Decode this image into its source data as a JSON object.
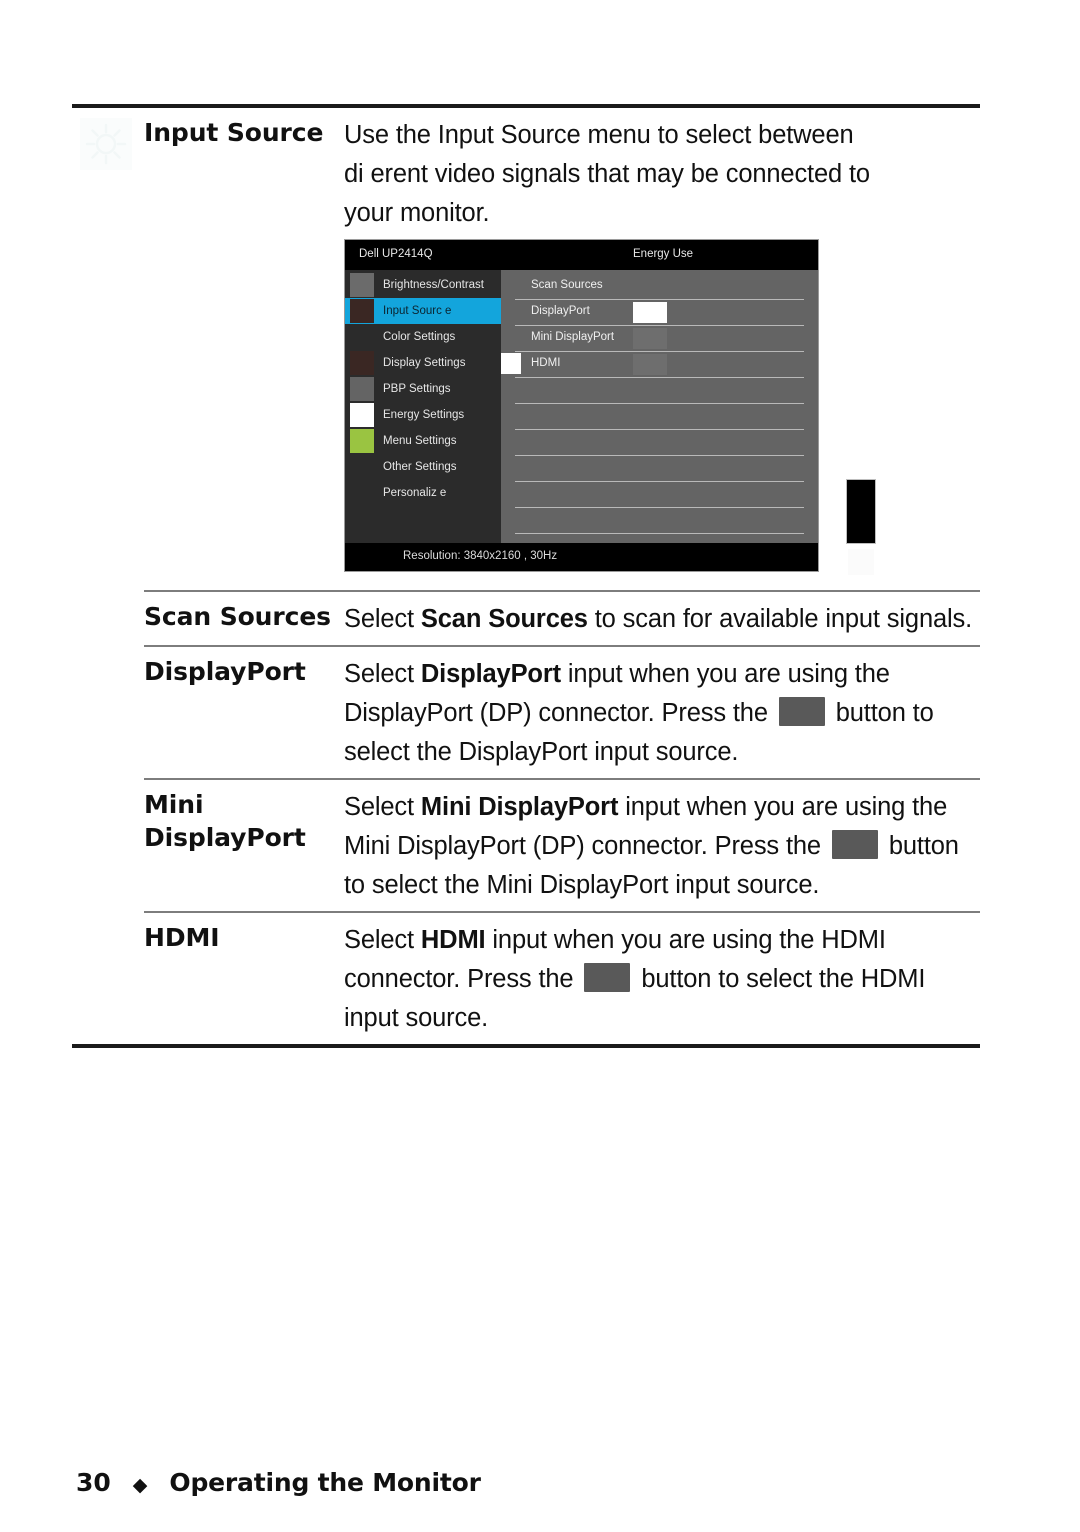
{
  "document": {
    "footer": {
      "page_number": "30",
      "separator": "◆",
      "section_title": "Operating the Monitor"
    }
  },
  "table": {
    "rows": [
      {
        "id": "input-source",
        "icon": "brightness-sun-icon",
        "label": "Input Source",
        "paragraphs": [
          "Use the Input Source menu to select between different video signals that may be connected to your monitor."
        ],
        "text_line1": "Use the Input Source menu to select between",
        "text_line2": "di erent video signals that may be connected to",
        "text_line3": "your monitor."
      },
      {
        "id": "scan-sources",
        "label": "Scan Sources",
        "before": "Select ",
        "bold": "Scan Sources",
        "after": " to scan for available input signals."
      },
      {
        "id": "displayport",
        "label": "DisplayPort",
        "before": "Select ",
        "bold": "DisplayPort",
        "mid": " input when you are using the DisplayPort (DP) connector. Press the ",
        "after": " button to select the DisplayPort input source."
      },
      {
        "id": "mini-displayport",
        "label_line1": "Mini",
        "label_line2": "DisplayPort",
        "label": "Mini DisplayPort",
        "before": "Select ",
        "bold": "Mini DisplayPort",
        "mid": " input when you are using the Mini DisplayPort (DP) connector. Press the ",
        "after": " button to select the Mini DisplayPort input source."
      },
      {
        "id": "hdmi",
        "label": "HDMI",
        "before": "Select ",
        "bold": "HDMI",
        "mid": " input when you are using the HDMI connector. Press the ",
        "after": " button to select the HDMI input source."
      }
    ]
  },
  "osd": {
    "model": "Dell UP2414Q",
    "energy_label": "Energy Use",
    "status": "Resolution: 3840x2160 , 30Hz",
    "colors": {
      "selected_highlight": "#13a5dc",
      "sidebar_bg": "#2b2b2b",
      "panel_bg": "#646464",
      "titlebar_bg": "#000000"
    },
    "menu_items": [
      {
        "label": "Brightness/Contrast",
        "swatch": "#6b6b6b",
        "selected": false
      },
      {
        "label": "Input Sourc e",
        "swatch": "#3a2723",
        "selected": true
      },
      {
        "label": "Color Settings",
        "swatch": "",
        "selected": false
      },
      {
        "label": "Display Settings",
        "swatch": "#3a2723",
        "selected": false
      },
      {
        "label": "PBP Settings",
        "swatch": "#646464",
        "selected": false
      },
      {
        "label": "Energy Settings",
        "swatch": "#ffffff",
        "selected": false
      },
      {
        "label": "Menu Settings",
        "swatch": "#9ac441",
        "selected": false
      },
      {
        "label": "Other Settings",
        "swatch": "",
        "selected": false
      },
      {
        "label": "Personaliz e",
        "swatch": "",
        "selected": false
      }
    ],
    "options": [
      {
        "label": "Scan Sources",
        "chip": false,
        "chip_active": false,
        "marker": false
      },
      {
        "label": "DisplayPort",
        "chip": true,
        "chip_active": true,
        "marker": false
      },
      {
        "label": "Mini DisplayPort",
        "chip": true,
        "chip_active": false,
        "marker": false
      },
      {
        "label": "HDMI",
        "chip": true,
        "chip_active": false,
        "marker": true
      },
      {
        "label": "",
        "chip": false,
        "chip_active": false,
        "marker": false
      },
      {
        "label": "",
        "chip": false,
        "chip_active": false,
        "marker": false
      },
      {
        "label": "",
        "chip": false,
        "chip_active": false,
        "marker": false
      },
      {
        "label": "",
        "chip": false,
        "chip_active": false,
        "marker": false
      },
      {
        "label": "",
        "chip": false,
        "chip_active": false,
        "marker": false
      },
      {
        "label": "",
        "chip": false,
        "chip_active": false,
        "marker": false
      }
    ]
  }
}
